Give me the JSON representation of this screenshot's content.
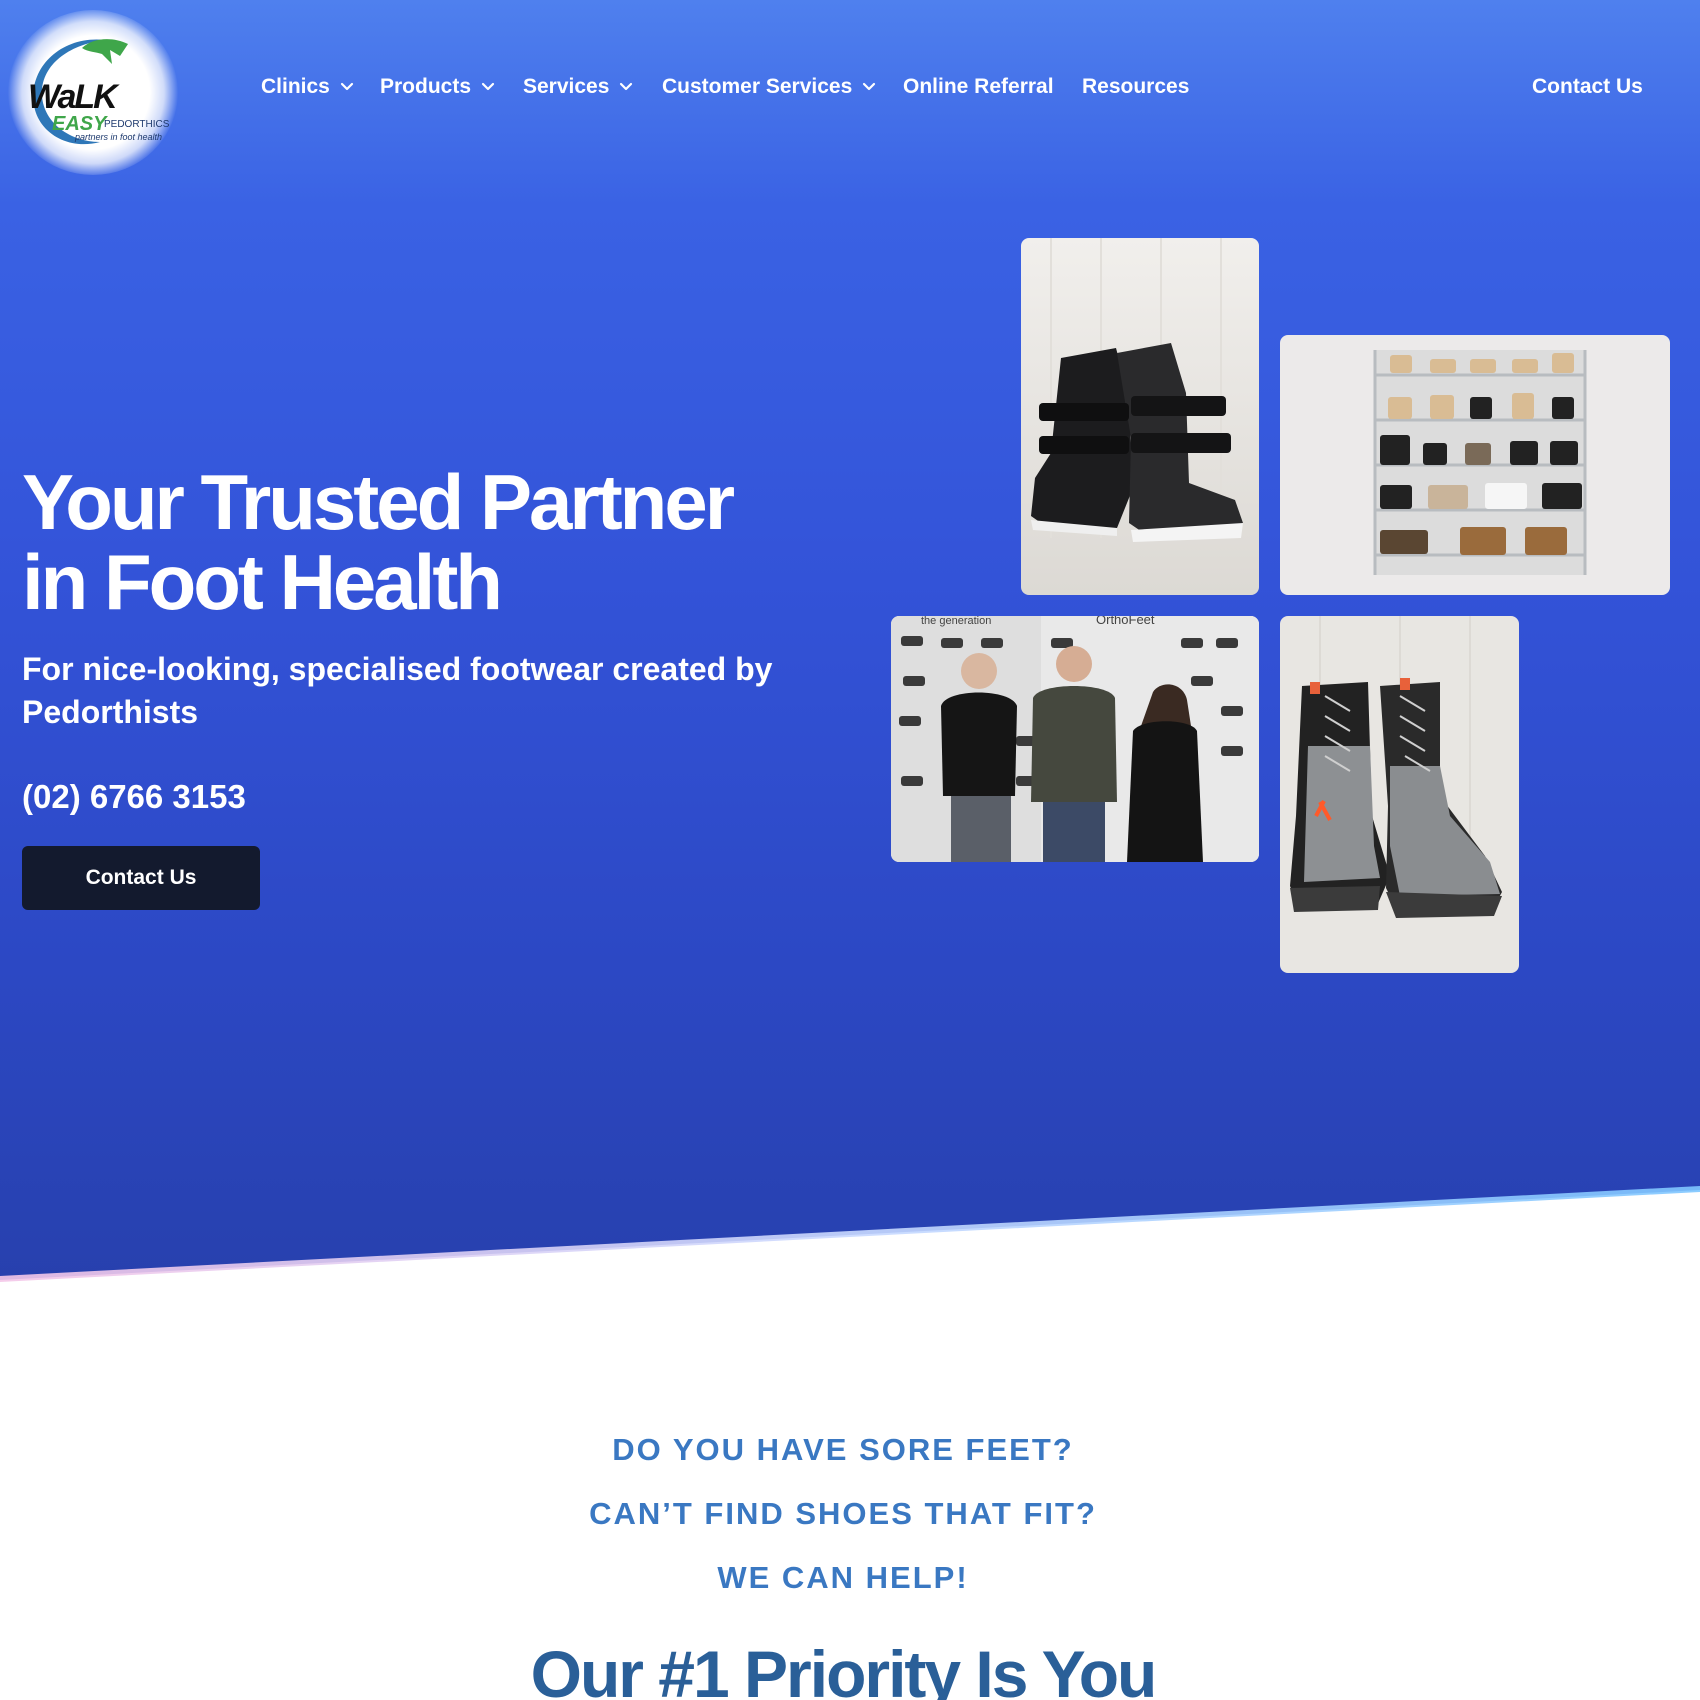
{
  "brand": {
    "logo_word1": "WaLK",
    "logo_word2": "EASY",
    "logo_word3": "PEDORTHICS",
    "logo_tagline": "partners in foot health"
  },
  "nav": {
    "items": [
      {
        "label": "Clinics",
        "has_dropdown": true
      },
      {
        "label": "Products",
        "has_dropdown": true
      },
      {
        "label": "Services",
        "has_dropdown": true
      },
      {
        "label": "Customer Services",
        "has_dropdown": true
      },
      {
        "label": "Online Referral",
        "has_dropdown": false
      },
      {
        "label": "Resources",
        "has_dropdown": false
      }
    ],
    "contact_label": "Contact Us"
  },
  "hero": {
    "title_line1": "Your Trusted Partner",
    "title_line2": "in Foot Health",
    "subtitle": "For nice-looking, specialised footwear created by Pedorthists",
    "phone": "(02) 6766 3153",
    "cta_label": "Contact Us",
    "shop_sign_1": "the generation",
    "shop_sign_2": "OrthoFeet"
  },
  "intro": {
    "question1": "DO YOU HAVE SORE FEET?",
    "question2": "CAN’T FIND SHOES THAT FIT?",
    "question3": "WE CAN HELP!",
    "heading": "Our #1 Priority Is You"
  },
  "colors": {
    "hero_top": "#4f80ee",
    "hero_bottom": "#2740ad",
    "button_bg": "#131a2e",
    "question_text": "#3a78c2",
    "heading_text": "#2a5f98"
  }
}
